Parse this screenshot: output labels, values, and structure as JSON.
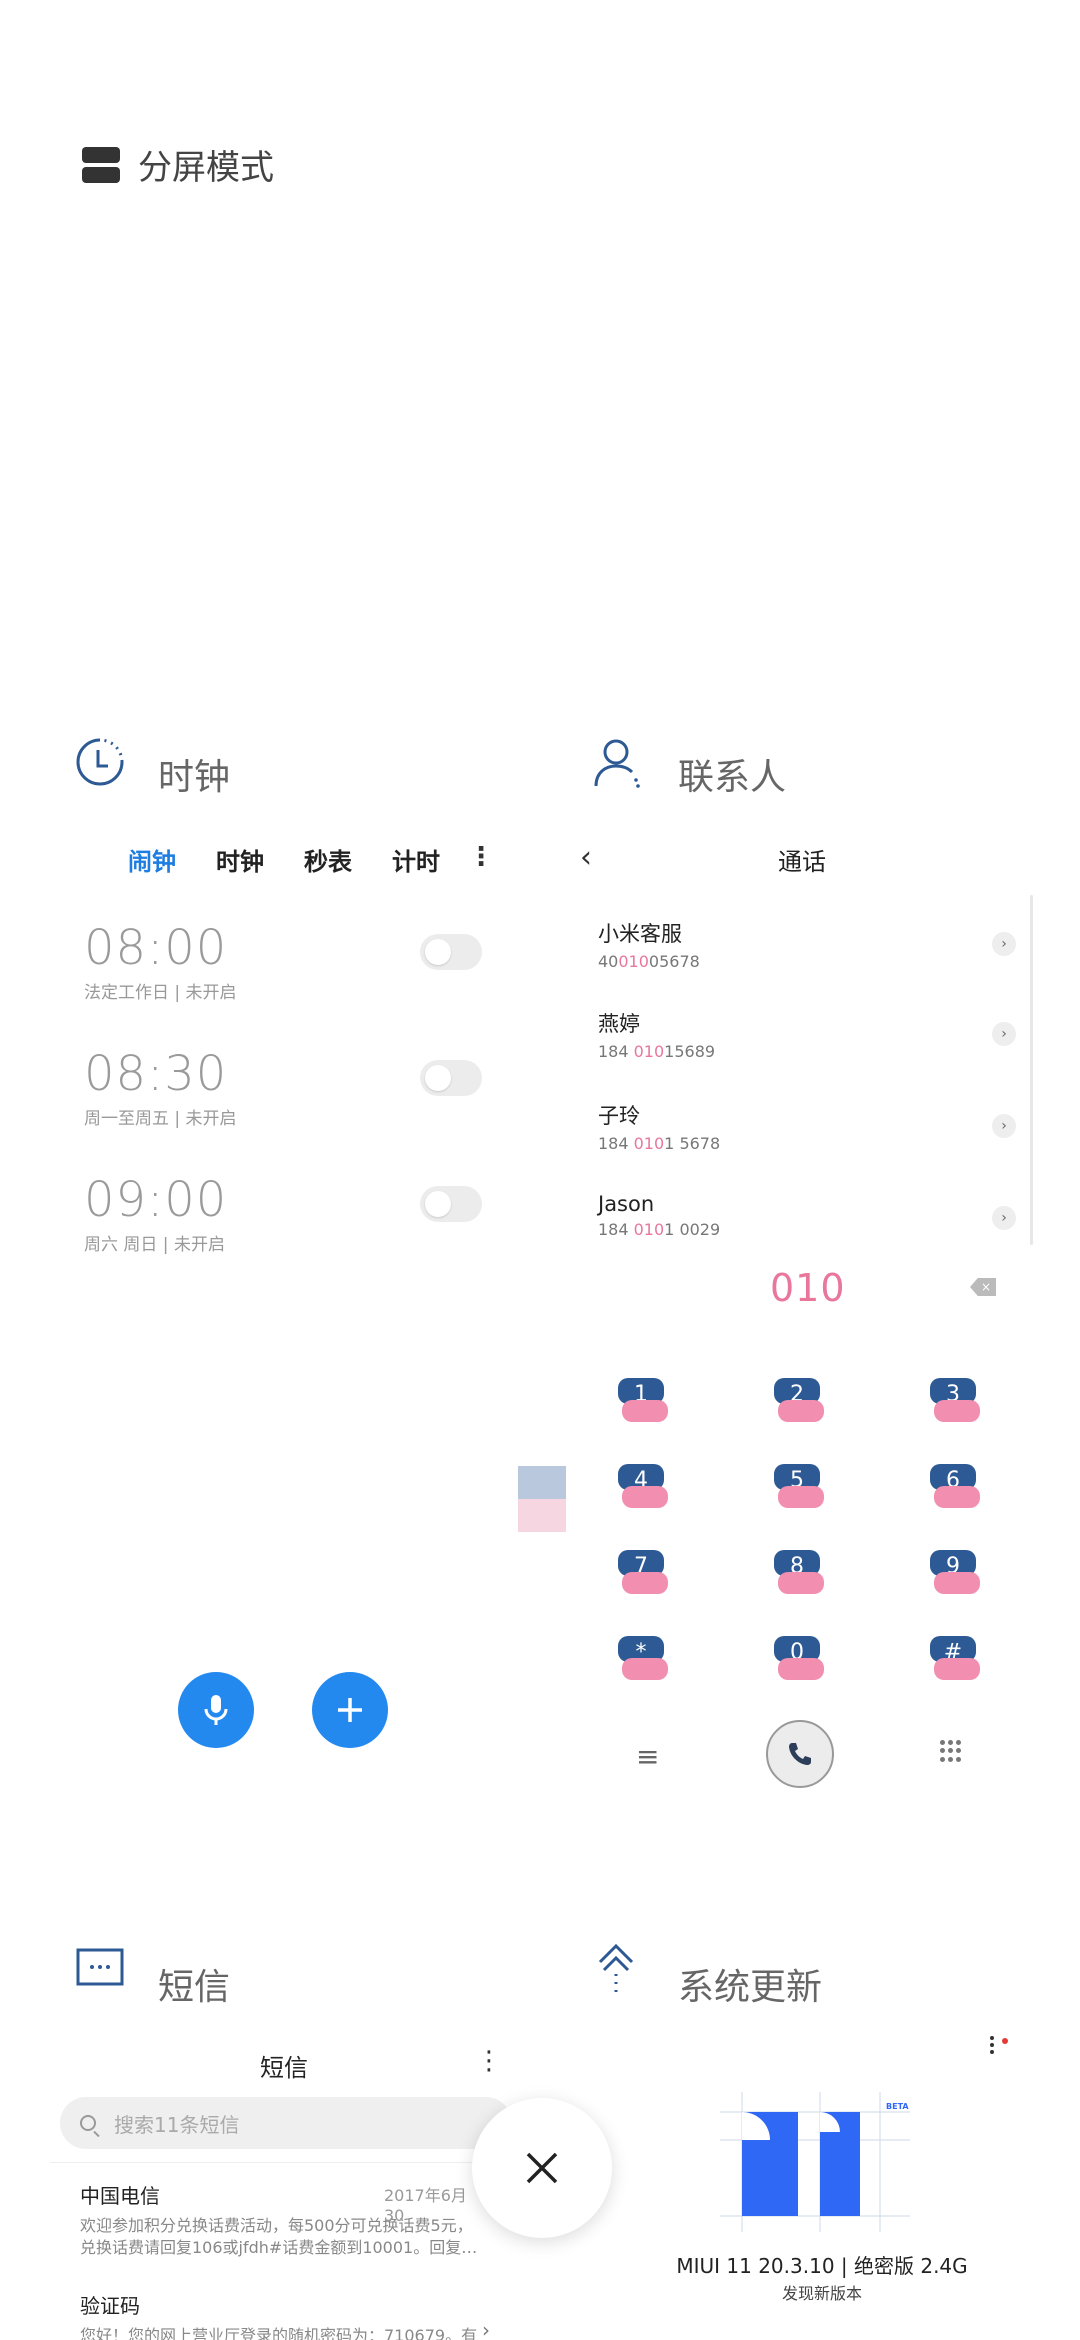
{
  "split_mode": {
    "title": "分屏模式"
  },
  "clock": {
    "app_title": "时钟",
    "tabs": [
      {
        "label": "闹钟",
        "active": true
      },
      {
        "label": "时钟",
        "active": false
      },
      {
        "label": "秒表",
        "active": false
      },
      {
        "label": "计时",
        "active": false
      }
    ],
    "more_glyph": "⋮",
    "alarms": [
      {
        "time": "08:00",
        "desc": "法定工作日 | 未开启",
        "enabled": false
      },
      {
        "time": "08:30",
        "desc": "周一至周五 | 未开启",
        "enabled": false
      },
      {
        "time": "09:00",
        "desc": "周六 周日 | 未开启",
        "enabled": false
      }
    ]
  },
  "contacts": {
    "app_title": "联系人",
    "section_title": "通话",
    "back_glyph": "‹",
    "list": [
      {
        "name": "小米客服",
        "num_pre": "40",
        "num_hl": "010",
        "num_post": "05678"
      },
      {
        "name": "燕婷",
        "num_pre": "184 ",
        "num_hl": "010",
        "num_post": "15689"
      },
      {
        "name": "子玲",
        "num_pre": "184 ",
        "num_hl": "010",
        "num_post": "1 5678"
      },
      {
        "name": "Jason",
        "num_pre": "184 ",
        "num_hl": "010",
        "num_post": "1 0029"
      }
    ],
    "dial_input": "010",
    "keys": [
      "1",
      "2",
      "3",
      "4",
      "5",
      "6",
      "7",
      "8",
      "9",
      "*",
      "0",
      "#"
    ],
    "menu_glyph": "≡"
  },
  "sms": {
    "app_title": "短信",
    "header_title": "短信",
    "more_glyph": "⋮",
    "search_placeholder": "搜索11条短信",
    "messages": [
      {
        "sender": "中国电信",
        "date": "2017年6月30",
        "body": "欢迎参加积分兑换话费活动，每500分可兑换话费5元，兑换话费请回复106或jfdh#话费金额到10001。回复…"
      },
      {
        "sender": "验证码",
        "date": "",
        "body": "您好！您的网上营业厅登录的随机密码为：710679。有"
      }
    ]
  },
  "updater": {
    "app_title": "系统更新",
    "version": "MIUI 11 20.3.10 | 绝密版 2.4G",
    "subtitle": "发现新版本",
    "badge": "BETA"
  },
  "colors": {
    "accent": "#1e7de0",
    "fab": "#2489ef",
    "dial_key": "#2d5a94",
    "dial_pink": "#f28fb1",
    "highlight": "#e8779b",
    "miui_blue": "#2f68f5"
  }
}
